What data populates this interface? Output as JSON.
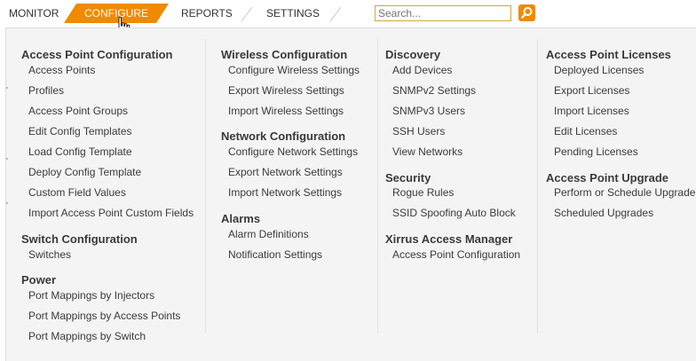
{
  "nav": {
    "monitor": "MONITOR",
    "configure": "CONFIGURE",
    "reports": "REPORTS",
    "settings": "SETTINGS",
    "search_placeholder": "Search...",
    "accent_color": "#f08a00"
  },
  "menu": {
    "ap_config": {
      "title": "Access Point Configuration",
      "items": [
        "Access Points",
        "Profiles",
        "Access Point Groups",
        "Edit Config Templates",
        "Load Config Template",
        "Deploy Config Template",
        "Custom Field Values",
        "Import Access Point Custom Fields"
      ]
    },
    "switch_config": {
      "title": "Switch Configuration",
      "items": [
        "Switches"
      ]
    },
    "power": {
      "title": "Power",
      "items": [
        "Port Mappings by Injectors",
        "Port Mappings by Access Points",
        "Port Mappings by Switch"
      ]
    },
    "wireless_config": {
      "title": "Wireless Configuration",
      "items": [
        "Configure Wireless Settings",
        "Export Wireless Settings",
        "Import Wireless Settings"
      ]
    },
    "network_config": {
      "title": "Network Configuration",
      "items": [
        "Configure Network Settings",
        "Export Network Settings",
        "Import Network Settings"
      ]
    },
    "alarms": {
      "title": "Alarms",
      "items": [
        "Alarm Definitions",
        "Notification Settings"
      ]
    },
    "discovery": {
      "title": "Discovery",
      "items": [
        "Add Devices",
        "SNMPv2 Settings",
        "SNMPv3 Users",
        "SSH Users",
        "View Networks"
      ]
    },
    "security": {
      "title": "Security",
      "items": [
        "Rogue Rules",
        "SSID Spoofing Auto Block"
      ]
    },
    "xam": {
      "title": "Xirrus Access Manager",
      "items": [
        "Access Point Configuration"
      ]
    },
    "ap_licenses": {
      "title": "Access Point Licenses",
      "items": [
        "Deployed Licenses",
        "Export Licenses",
        "Import Licenses",
        "Edit Licenses",
        "Pending Licenses"
      ]
    },
    "ap_upgrade": {
      "title": "Access Point Upgrade",
      "items": [
        "Perform or Schedule Upgrade",
        "Scheduled Upgrades"
      ]
    }
  }
}
